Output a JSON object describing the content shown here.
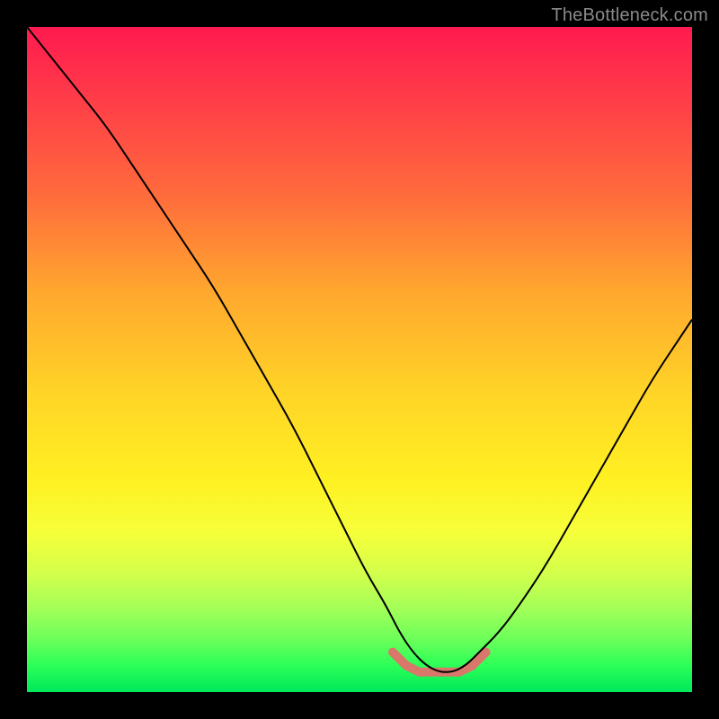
{
  "watermark": "TheBottleneck.com",
  "chart_data": {
    "type": "line",
    "title": "",
    "xlabel": "",
    "ylabel": "",
    "xlim": [
      0,
      100
    ],
    "ylim": [
      0,
      100
    ],
    "grid": false,
    "legend": false,
    "note": "Axes are unlabeled in the source image; values are normalized 0–100 estimated from pixel positions. The main black curve is a V-shape with its minimum near x≈62. The short salmon segment highlights the flat bottom of the valley.",
    "series": [
      {
        "name": "bottleneck-curve",
        "color": "#000000",
        "stroke_width": 2,
        "x": [
          0,
          4,
          8,
          12,
          16,
          20,
          24,
          28,
          32,
          36,
          40,
          44,
          48,
          51,
          54,
          56,
          58,
          60,
          62,
          64,
          66,
          68,
          71,
          74,
          78,
          82,
          86,
          90,
          94,
          98,
          100
        ],
        "y": [
          100,
          95,
          90,
          85,
          79,
          73,
          67,
          61,
          54,
          47,
          40,
          32,
          24,
          18,
          13,
          9,
          6,
          4,
          3,
          3,
          4,
          6,
          9,
          13,
          19,
          26,
          33,
          40,
          47,
          53,
          56
        ]
      },
      {
        "name": "valley-highlight",
        "color": "#d9776b",
        "stroke_width": 10,
        "linecap": "round",
        "x": [
          55,
          57,
          59,
          61,
          63,
          65,
          67,
          69
        ],
        "y": [
          6,
          4,
          3,
          3,
          3,
          3,
          4,
          6
        ]
      }
    ]
  }
}
